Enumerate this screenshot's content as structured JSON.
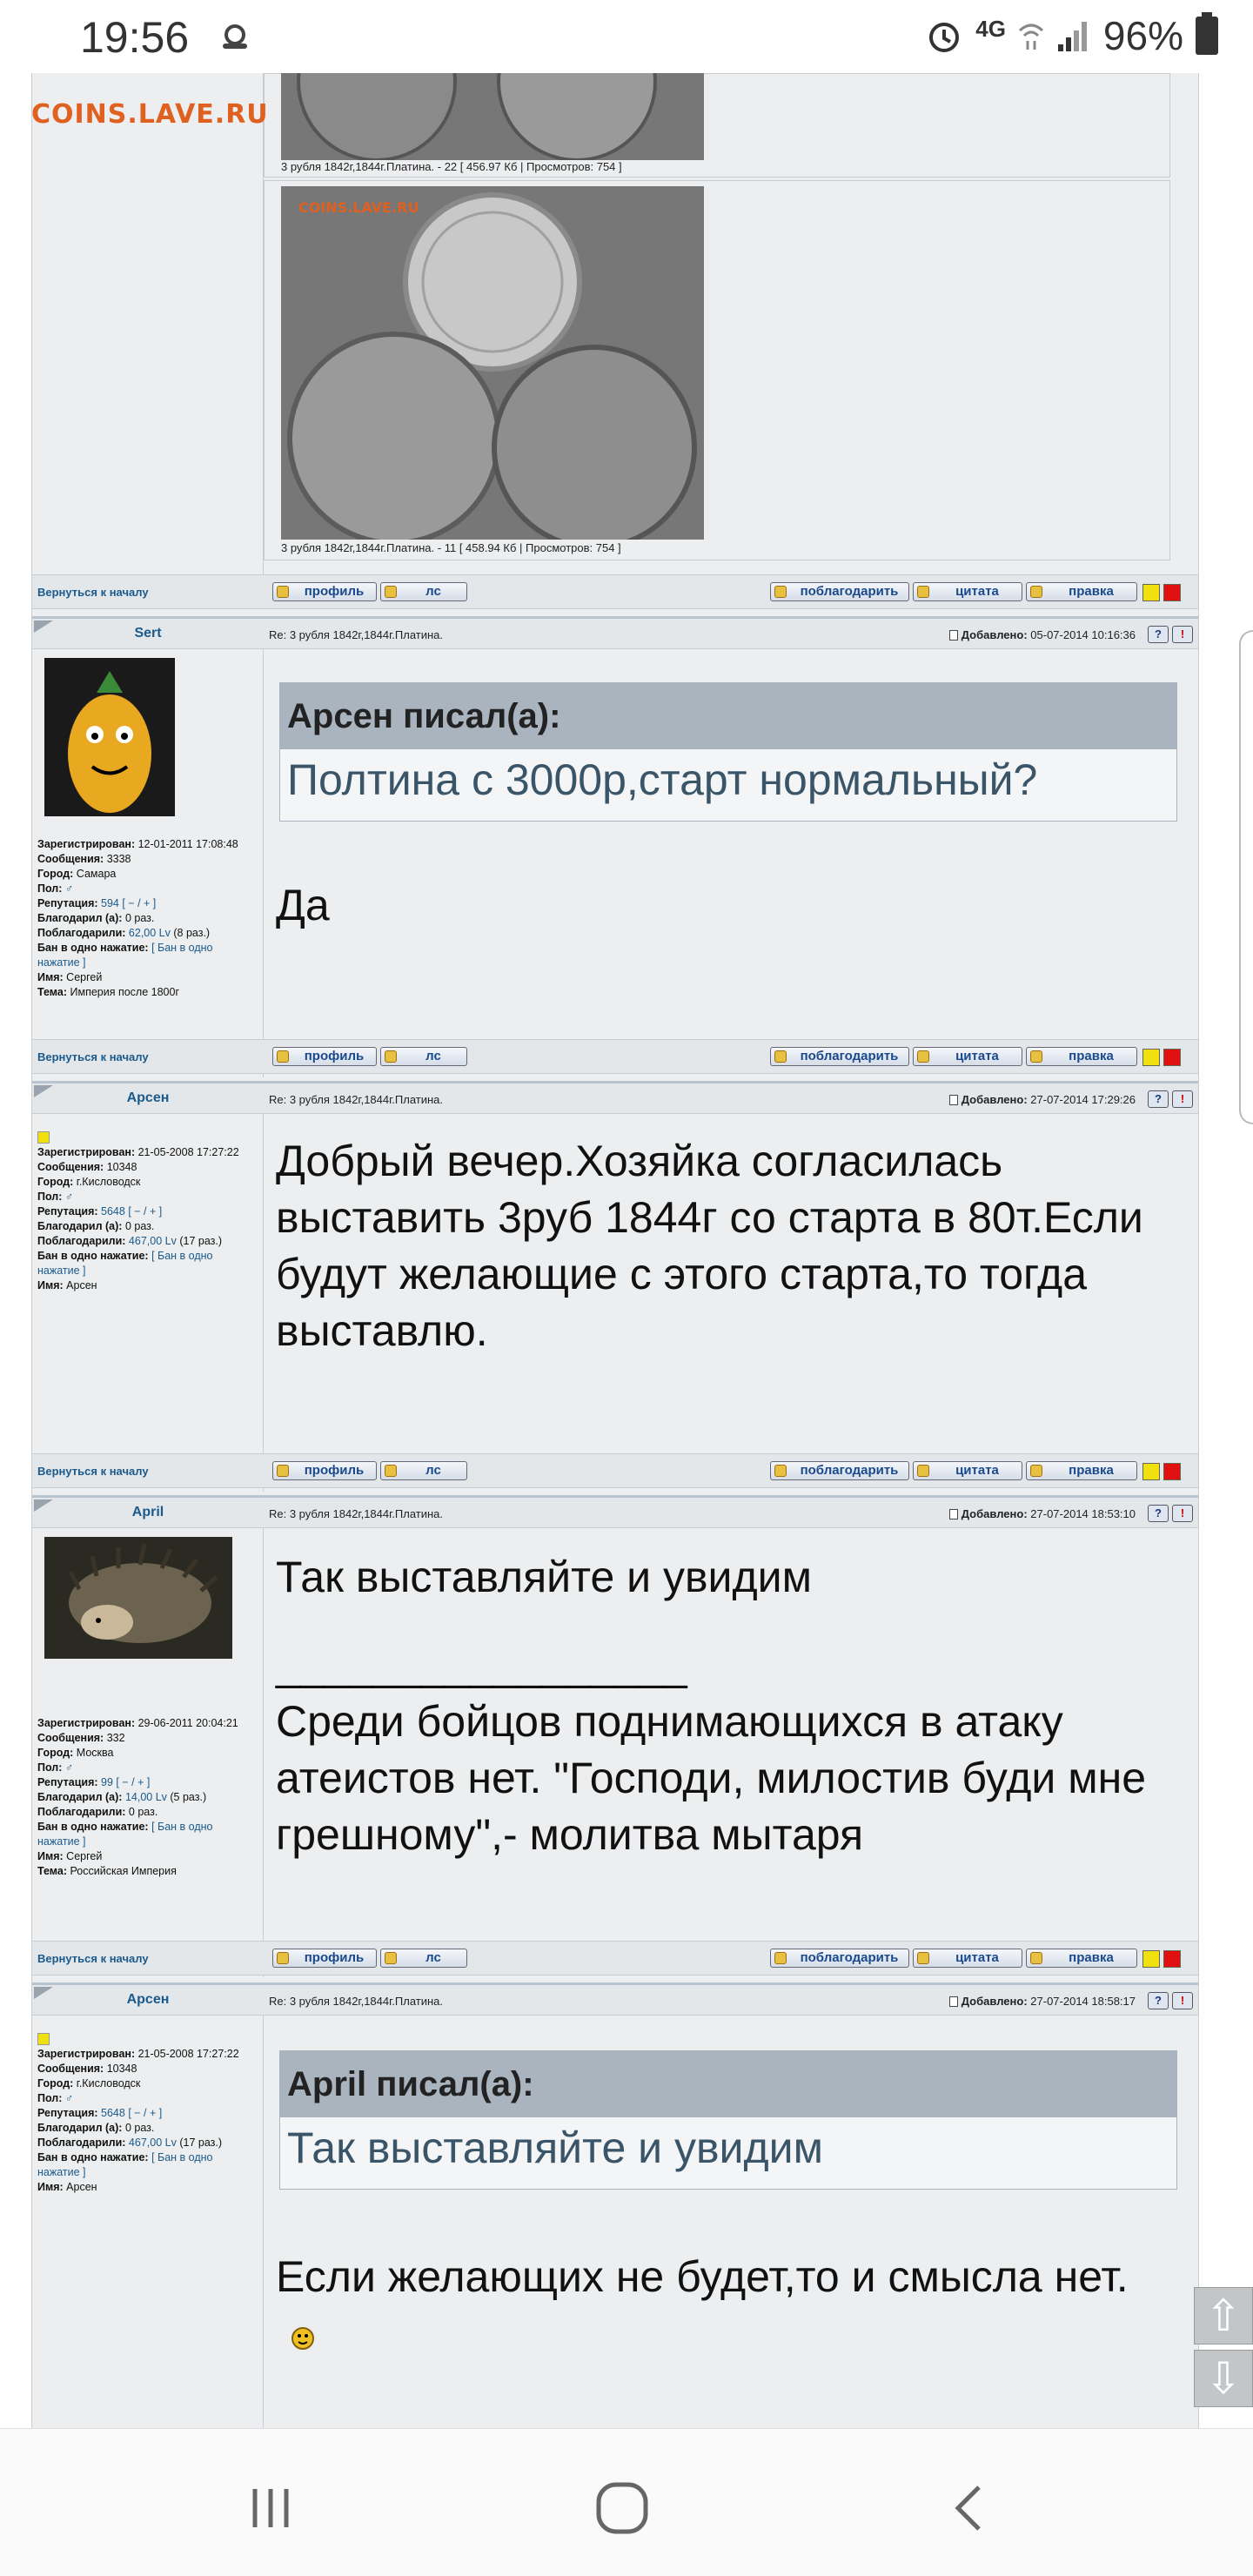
{
  "status": {
    "time": "19:56",
    "network": "4G",
    "battery": "96%"
  },
  "watermark": "COINS.LAVE.RU",
  "watermark_small": "COINS.LAVE.RU",
  "images": [
    {
      "caption": "3 рубля 1842г,1844г.Платина. - 22 [ 456.97 Кб | Просмотров: 754 ]"
    },
    {
      "caption": "3 рубля 1842г,1844г.Платина. - 11 [ 458.94 Кб | Просмотров: 754 ]"
    }
  ],
  "common": {
    "back": "Вернуться к началу",
    "profile": "профиль",
    "pm": "лс",
    "thank": "поблагодарить",
    "quote": "цитата",
    "edit": "правка",
    "added_label": "Добавлено:",
    "help": "?",
    "warn": "!"
  },
  "posts": [
    {
      "author": "Sert",
      "subject": "Re: 3 рубля 1842г,1844г.Платина.",
      "added": "05-07-2014 10:16:36",
      "profile": {
        "registered_label": "Зарегистрирован:",
        "registered": "12-01-2011 17:08:48",
        "messages_label": "Сообщения:",
        "messages": "3338",
        "city_label": "Город:",
        "city": "Самара",
        "gender_label": "Пол:",
        "rep_label": "Репутация:",
        "rep": "594",
        "rep_links": "[ − / + ]",
        "thanked_label": "Благодарил (а):",
        "thanked": "0 раз.",
        "got_label": "Поблагодарили:",
        "got": "62,00 Lv",
        "got_times": "(8 раз.)",
        "ban_label": "Бан в одно нажатие:",
        "ban": "[ Бан в одно нажатие ]",
        "name_label": "Имя:",
        "name": "Сергей",
        "topic_label": "Тема:",
        "topic": "Империя после 1800г"
      },
      "quote_head": "Арсен писал(а):",
      "quote_text": "Полтина с 3000р,старт нормальный?",
      "text": "Да"
    },
    {
      "author": "Арсен",
      "subject": "Re: 3 рубля 1842г,1844г.Платина.",
      "added": "27-07-2014 17:29:26",
      "profile": {
        "registered_label": "Зарегистрирован:",
        "registered": "21-05-2008 17:27:22",
        "messages_label": "Сообщения:",
        "messages": "10348",
        "city_label": "Город:",
        "city": "г.Кисловодск",
        "gender_label": "Пол:",
        "rep_label": "Репутация:",
        "rep": "5648",
        "rep_links": "[ − / + ]",
        "thanked_label": "Благодарил (а):",
        "thanked": "0 раз.",
        "got_label": "Поблагодарили:",
        "got": "467,00 Lv",
        "got_times": "(17 раз.)",
        "ban_label": "Бан в одно нажатие:",
        "ban": "[ Бан в одно нажатие ]",
        "name_label": "Имя:",
        "name": "Арсен"
      },
      "text": "Добрый вечер.Хозяйка согласилась выставить 3руб 1844г со старта в 80т.Если будут желающие с этого старта,то тогда выставлю."
    },
    {
      "author": "April",
      "subject": "Re: 3 рубля 1842г,1844г.Платина.",
      "added": "27-07-2014 18:53:10",
      "profile": {
        "registered_label": "Зарегистрирован:",
        "registered": "29-06-2011 20:04:21",
        "messages_label": "Сообщения:",
        "messages": "332",
        "city_label": "Город:",
        "city": "Москва",
        "gender_label": "Пол:",
        "rep_label": "Репутация:",
        "rep": "99",
        "rep_links": "[ − / + ]",
        "thanked_label": "Благодарил (а):",
        "thanked": "14,00 Lv",
        "thanked_times": "(5 раз.)",
        "got_label": "Поблагодарили:",
        "got": "0 раз.",
        "ban_label": "Бан в одно нажатие:",
        "ban": "[ Бан в одно нажатие ]",
        "name_label": "Имя:",
        "name": "Сергей",
        "topic_label": "Тема:",
        "topic": "Российская Империя"
      },
      "text": "Так выставляйте и увидим",
      "signature_line": "_________________",
      "signature": "Среди бойцов поднимающихся в атаку атеистов нет. \"Господи, милостив буди мне грешному\",- молитва мытаря"
    },
    {
      "author": "Арсен",
      "subject": "Re: 3 рубля 1842г,1844г.Платина.",
      "added": "27-07-2014 18:58:17",
      "profile": {
        "registered_label": "Зарегистрирован:",
        "registered": "21-05-2008 17:27:22",
        "messages_label": "Сообщения:",
        "messages": "10348",
        "city_label": "Город:",
        "city": "г.Кисловодск",
        "gender_label": "Пол:",
        "rep_label": "Репутация:",
        "rep": "5648",
        "rep_links": "[ − / + ]",
        "thanked_label": "Благодарил (а):",
        "thanked": "0 раз.",
        "got_label": "Поблагодарили:",
        "got": "467,00 Lv",
        "got_times": "(17 раз.)",
        "ban_label": "Бан в одно нажатие:",
        "ban": "[ Бан в одно нажатие ]",
        "name_label": "Имя:",
        "name": "Арсен"
      },
      "quote_head": "April писал(а):",
      "quote_text": "Так выставляйте и увидим",
      "text": "Если желающих не будет,то и смысла нет."
    }
  ],
  "scroll": {
    "up": "⇧",
    "down": "⇩"
  }
}
